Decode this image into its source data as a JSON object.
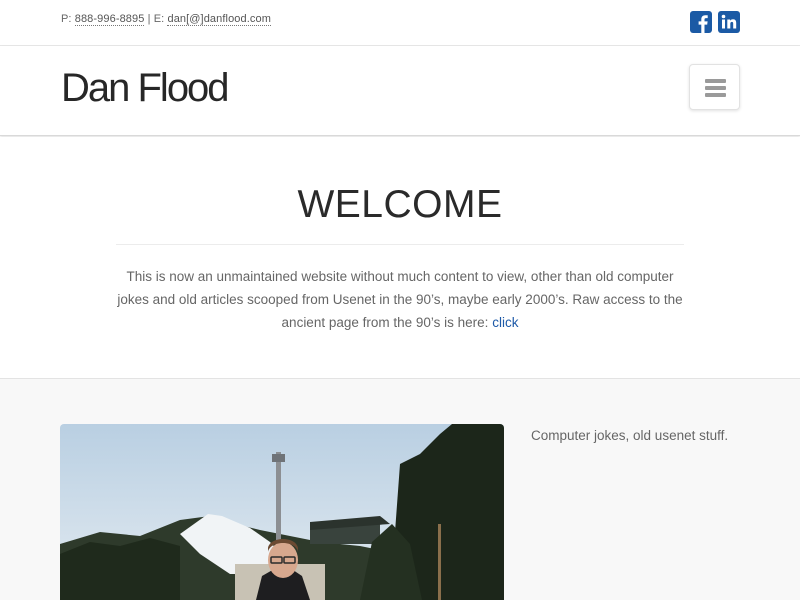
{
  "topbar": {
    "phone_prefix": "P:",
    "phone": "888-996-8895",
    "separator": "|",
    "email_prefix": "E:",
    "email": "dan[@]danflood.com",
    "social": [
      {
        "name": "facebook-icon",
        "color": "#1b5aa5"
      },
      {
        "name": "linkedin-icon",
        "color": "#1b5aa5"
      }
    ]
  },
  "navbar": {
    "brand": "Dan Flood",
    "menu_icon": "hamburger-menu-icon"
  },
  "welcome": {
    "title": "WELCOME",
    "body": "This is now an unmaintained website without much content to view, other than old computer jokes and old articles scooped from Usenet in the 90’s, maybe early 2000’s. Raw access to the ancient page from the 90’s is here:",
    "link_text": "click"
  },
  "content": {
    "sidebar_text": "Computer jokes, old usenet stuff."
  },
  "colors": {
    "accent": "#1b5aa5",
    "link": "#1e5aa8",
    "content_bg": "#f8f8f8"
  }
}
